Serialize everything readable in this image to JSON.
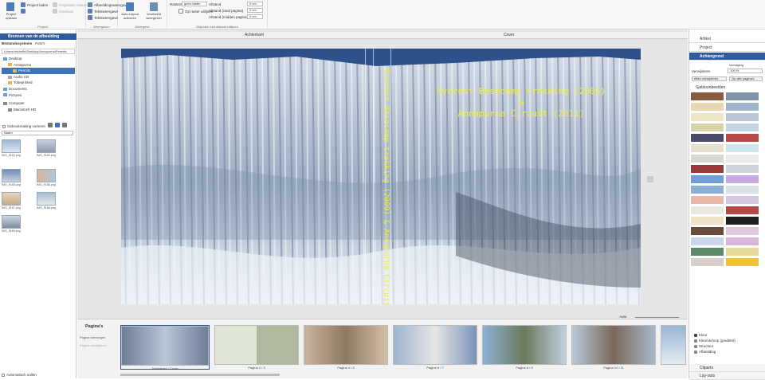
{
  "ribbon": {
    "project_new": "Project opslaan",
    "project_new2": "Project laden",
    "project_group": "Project",
    "undo": "Ongedaan maken",
    "redo": "Opnieuw",
    "loader1": "Afbeeldingsweergave",
    "loader2": "Tekstweergave",
    "loader3": "Tekstweergave",
    "views_group": "Weergaven",
    "autolayout": "Auto-Layout activeren",
    "preview": "Voorbeeld weergeven",
    "views2_group": "Weergave",
    "raster_label": "Rasters",
    "raster_value": "geen raster",
    "snap_label": "Op raster uitlijnen",
    "dist1_label": "Afstand",
    "dist1_value": "0 cm",
    "dist2_label": "Afstand (rand pagina)",
    "dist2_value": "0 cm",
    "dist3_label": "Afstand (midden pagina)",
    "dist3_value": "0 cm",
    "align_group": "Objecten met afstand uitlijnen"
  },
  "left": {
    "header": "Bronnen van de afbeelding",
    "tab1": "Bestandssysteem",
    "tab2": "Foto's",
    "path": "/Users/michelle/Desktop/Annapurna/Permits",
    "tree": [
      "Desktop",
      "Annapurna",
      "Permits",
      "Audio CD",
      "Tobeprinted",
      "Documents",
      "Pictures",
      "Computer",
      "Macintosh HD"
    ],
    "sort_label": "Gebruikmaking sorteren",
    "sort_value": "Naam",
    "thumbs": [
      "IMG_9183.png",
      "IMG_9184.png",
      "IMG_9185.png",
      "IMG_9186.png",
      "IMG_9187.png",
      "IMG_9188.png",
      "IMG_9189.png"
    ],
    "footer": "Automatisch vullen"
  },
  "canvas": {
    "back_label": "Achterkant",
    "cover_label": "Cover",
    "title_line1": "Everest Basecamp trekking (2009)",
    "title_line2": "&",
    "title_line3": "Annapurna Circuit (2011)",
    "spine_text": "Everest Basecamp trekking (2009) & Annapurna Circuit (2011)",
    "zoom": "Auto"
  },
  "pages": {
    "title": "Pagina's",
    "side1": "Pagina toevoegen",
    "side2": "Pagina verwijderen",
    "items": [
      "Achterkant / Cover",
      "Pagina 2 / 3",
      "Pagina 4 / 5",
      "Pagina 6 / 7",
      "Pagina 8 / 9",
      "Pagina 10 / 11",
      ""
    ]
  },
  "right": {
    "tabs": [
      "Artikel",
      "Project",
      "Achtergrond"
    ],
    "opacity_label": "Vervaging",
    "opacity_value": "100 %",
    "scale_label": "Verwijderen",
    "btn_remove": "Alles verwijderen",
    "btn_all": "Op alle pagina's",
    "presets": "Sjabloonbeelden",
    "list": [
      "Kleur",
      "Kleurverloop (gradiënt)",
      "Structuur",
      "Afbeelding"
    ],
    "cliparts": "Cliparts",
    "layouts": "Lay-outs"
  }
}
